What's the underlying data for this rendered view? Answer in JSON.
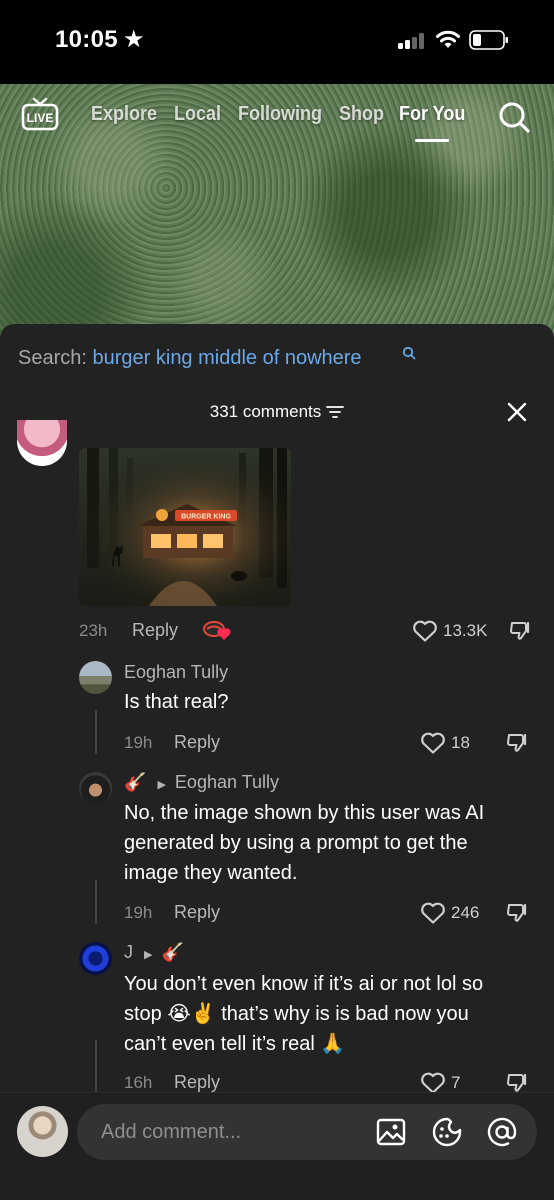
{
  "status_bar": {
    "time": "10:05",
    "star": "★",
    "icons": [
      "signal-icon",
      "wifi-icon",
      "battery-icon"
    ]
  },
  "top_nav": {
    "live_label": "LIVE",
    "tabs": [
      {
        "label": "Explore",
        "active": false
      },
      {
        "label": "Local",
        "active": false
      },
      {
        "label": "Following",
        "active": false
      },
      {
        "label": "Shop",
        "active": false
      },
      {
        "label": "For You",
        "active": true
      }
    ]
  },
  "comments_sheet": {
    "search_prefix": "Search:",
    "search_term": "burger king middle of nowhere",
    "count_label": "331 comments",
    "image_sign_text": "BURGER KING",
    "comments": [
      {
        "time": "23h",
        "reply_label": "Reply",
        "likes": "13.3K"
      },
      {
        "username": "Eoghan Tully",
        "text": "Is that real?",
        "time": "19h",
        "reply_label": "Reply",
        "likes": "18"
      },
      {
        "user_emoji": "🎸",
        "reply_to": "Eoghan Tully",
        "text_lines": [
          "No, the image shown by this user was AI",
          "generated by using a prompt to get the",
          "image they wanted."
        ],
        "time": "19h",
        "reply_label": "Reply",
        "likes": "246"
      },
      {
        "username": "J",
        "reply_to_emoji": "🎸",
        "text_lines": [
          "You don’t even know if it’s ai or not lol so",
          "stop 😭✌️ that’s why is is bad now you",
          "can’t even tell it’s real 🙏"
        ],
        "time": "16h",
        "reply_label": "Reply",
        "likes": "7"
      }
    ]
  },
  "bottom_bar": {
    "placeholder": "Add comment...",
    "icons": [
      "image-icon",
      "sticker-icon",
      "mention-icon"
    ]
  },
  "colors": {
    "sheet_bg": "#222222",
    "search_term": "#6aa8e8",
    "input_bg": "#333333"
  }
}
